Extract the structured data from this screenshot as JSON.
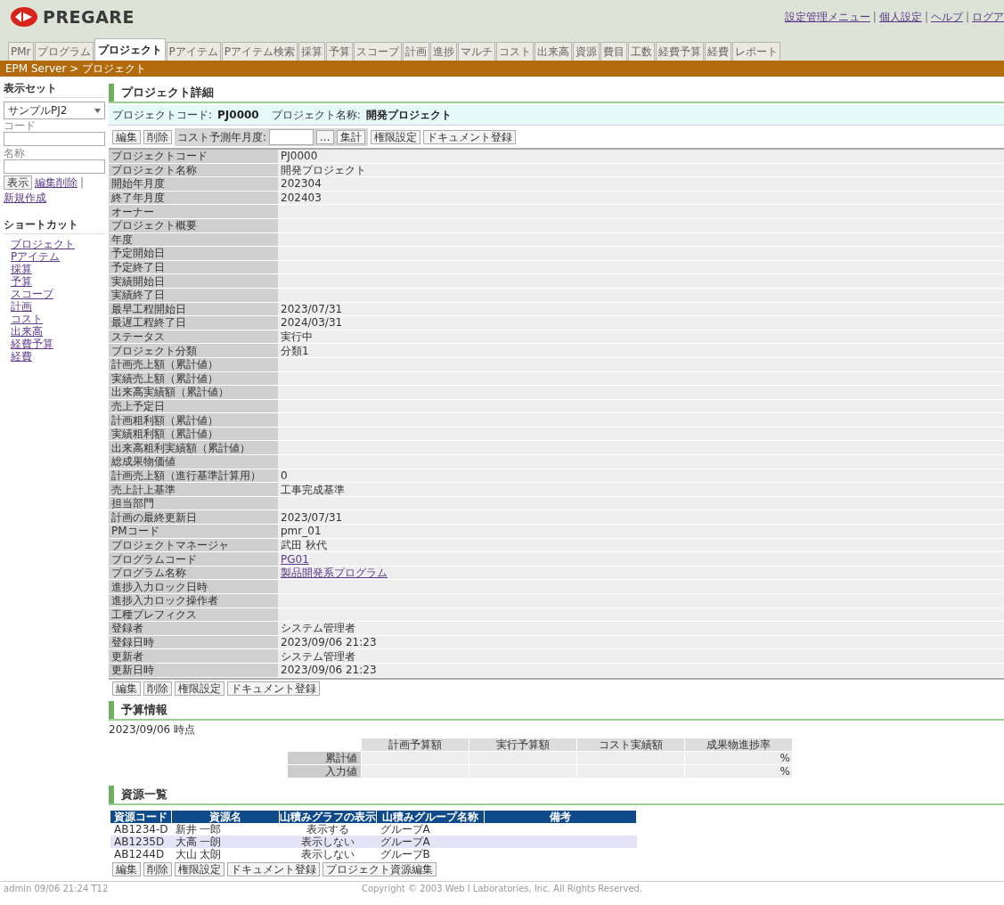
{
  "header": {
    "logo": "PREGARE",
    "links": [
      "設定管理メニュー",
      "個人設定",
      "ヘルプ",
      "ログア"
    ],
    "separators": [
      "|",
      "|",
      "|"
    ]
  },
  "tabs": [
    {
      "label": "PMr",
      "selected": false
    },
    {
      "label": "プログラム",
      "selected": false
    },
    {
      "label": "プロジェクト",
      "selected": true
    },
    {
      "label": "Pアイテム",
      "selected": false
    },
    {
      "label": "Pアイテム検索",
      "selected": false
    },
    {
      "label": "採算",
      "selected": false
    },
    {
      "label": "予算",
      "selected": false
    },
    {
      "label": "スコープ",
      "selected": false
    },
    {
      "label": "計画",
      "selected": false
    },
    {
      "label": "進捗",
      "selected": false
    },
    {
      "label": "マルチ",
      "selected": false
    },
    {
      "label": "コスト",
      "selected": false
    },
    {
      "label": "出来高",
      "selected": false
    },
    {
      "label": "資源",
      "selected": false
    },
    {
      "label": "費目",
      "selected": false
    },
    {
      "label": "工数",
      "selected": false
    },
    {
      "label": "経費予算",
      "selected": false
    },
    {
      "label": "経費",
      "selected": false
    },
    {
      "label": "レポート",
      "selected": false
    }
  ],
  "breadcrumb": "EPM Server > プロジェクト",
  "sidebar": {
    "display_set_heading": "表示セット",
    "display_set": "サンプルPJ2",
    "code_label": "コード",
    "name_label": "名称",
    "show_button": "表示",
    "links": [
      "編集削除",
      "新規作成"
    ],
    "separator": "|",
    "shortcut_heading": "ショートカット",
    "shortcuts": [
      "プロジェクト",
      "Pアイテム",
      "採算",
      "予算",
      "スコープ",
      "計画",
      "コスト",
      "出来高",
      "経費予算",
      "経費"
    ]
  },
  "detail": {
    "title": "プロジェクト詳細",
    "info": [
      {
        "label": "プロジェクトコード:",
        "value": "PJ0000"
      },
      {
        "label": "プロジェクト名称:",
        "value": "開発プロジェクト"
      }
    ],
    "toolbar": {
      "buttons_before": [
        "編集",
        "削除"
      ],
      "period_label": "コスト予測年月度:",
      "picker_button": "...",
      "buttons_after": [
        "集計",
        "権限設定",
        "ドキュメント登録"
      ]
    },
    "rows": [
      {
        "label": "プロジェクトコード",
        "value": "PJ0000"
      },
      {
        "label": "プロジェクト名称",
        "value": "開発プロジェクト"
      },
      {
        "label": "開始年月度",
        "value": "202304"
      },
      {
        "label": "終了年月度",
        "value": "202403"
      },
      {
        "label": "オーナー"
      },
      {
        "label": "プロジェクト概要"
      },
      {
        "label": "年度"
      },
      {
        "label": "予定開始日"
      },
      {
        "label": "予定終了日"
      },
      {
        "label": "実績開始日"
      },
      {
        "label": "実績終了日"
      },
      {
        "label": "最早工程開始日",
        "value": "2023/07/31"
      },
      {
        "label": "最遅工程終了日",
        "value": "2024/03/31"
      },
      {
        "label": "ステータス",
        "value": "実行中"
      },
      {
        "label": "プロジェクト分類",
        "value": "分類1"
      },
      {
        "label": "計画売上額（累計値）"
      },
      {
        "label": "実績売上額（累計値）"
      },
      {
        "label": "出来高実績額（累計値）"
      },
      {
        "label": "売上予定日"
      },
      {
        "label": "計画粗利額（累計値）"
      },
      {
        "label": "実績粗利額（累計値）"
      },
      {
        "label": "出来高粗利実績額（累計値）"
      },
      {
        "label": "総成果物価値"
      },
      {
        "label": "計画売上額（進行基準計算用）",
        "value": "0"
      },
      {
        "label": "売上計上基準",
        "value": "工事完成基準"
      },
      {
        "label": "担当部門"
      },
      {
        "label": "計画の最終更新日",
        "value": "2023/07/31"
      },
      {
        "label": "PMコード",
        "value": "pmr_01"
      },
      {
        "label": "プロジェクトマネージャ",
        "value": "武田 秋代"
      },
      {
        "label": "プログラムコード",
        "value": "PG01",
        "kind": "link"
      },
      {
        "label": "プログラム名称",
        "value": "製品開発系プログラム",
        "kind": "link"
      },
      {
        "label": "進捗入力ロック日時"
      },
      {
        "label": "進捗入力ロック操作者"
      },
      {
        "label": "工種プレフィクス"
      },
      {
        "label": "登録者",
        "value": "システム管理者"
      },
      {
        "label": "登録日時",
        "value": "2023/09/06 21:23"
      },
      {
        "label": "更新者",
        "value": "システム管理者"
      },
      {
        "label": "更新日時",
        "value": "2023/09/06 21:23"
      }
    ],
    "bottom_buttons": [
      "編集",
      "削除",
      "権限設定",
      "ドキュメント登録"
    ]
  },
  "budget": {
    "title": "予算情報",
    "as_of": "2023/09/06 時点",
    "columns": [
      "計画予算額",
      "実行予算額",
      "コスト実績額",
      "成果物進捗率"
    ],
    "rows": [
      {
        "label": "累計値",
        "unit": "%"
      },
      {
        "label": "入力値",
        "unit": "%"
      }
    ]
  },
  "resources": {
    "title": "資源一覧",
    "columns": [
      "資源コード",
      "資源名",
      "山積みグラフの表示",
      "山積みグループ名称",
      "備考"
    ],
    "rows": [
      {
        "cells": [
          "AB1234-D",
          "新井 一郎",
          "表示する",
          "グループA"
        ]
      },
      {
        "cells": [
          "AB1235D",
          "大高 一朗",
          "表示しない",
          "グループA"
        ]
      },
      {
        "cells": [
          "AB1244D",
          "大山 太朗",
          "表示しない",
          "グループB"
        ]
      }
    ],
    "buttons": [
      "編集",
      "削除",
      "権限設定",
      "ドキュメント登録",
      "プロジェクト資源編集"
    ]
  },
  "footer": {
    "status": "admin  09/06 21:24  T12",
    "copyright": "Copyright © 2003 Web I Laboratories, Inc. All Rights Reserved."
  }
}
